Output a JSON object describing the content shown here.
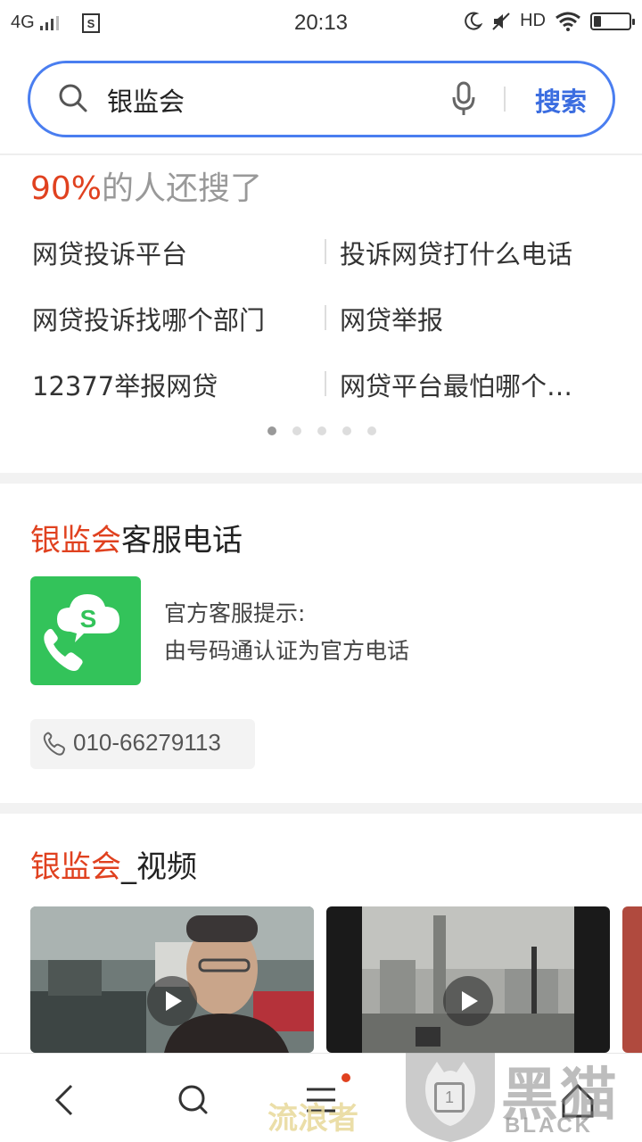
{
  "status_bar": {
    "network": "4G",
    "time": "20:13",
    "hd": "HD"
  },
  "search": {
    "query": "银监会",
    "button_label": "搜索"
  },
  "also_searched": {
    "percent": "90%",
    "title_suffix": "的人还搜了",
    "items": [
      "网贷投诉平台",
      "投诉网贷打什么电话",
      "网贷投诉找哪个部门",
      "网贷举报",
      "12377举报网贷",
      "网贷平台最怕哪个…"
    ],
    "page_count": 5,
    "active_page": 1
  },
  "phone_card": {
    "title_highlight": "银监会",
    "title_suffix": "客服电话",
    "tip_title": "官方客服提示:",
    "tip_body": "由号码通认证为官方电话",
    "phone_number": "010-66279113"
  },
  "video_card": {
    "title_highlight": "银监会",
    "title_suffix": "_视频"
  },
  "bottom_nav": {
    "tab_count": "1"
  },
  "watermark": {
    "cn_text": "流浪者",
    "brand_cn": "黑猫",
    "brand_en": "BLACK CAT"
  },
  "colors": {
    "accent_blue": "#3b6de0",
    "highlight_red": "#e0411f",
    "app_green": "#33c35a"
  }
}
